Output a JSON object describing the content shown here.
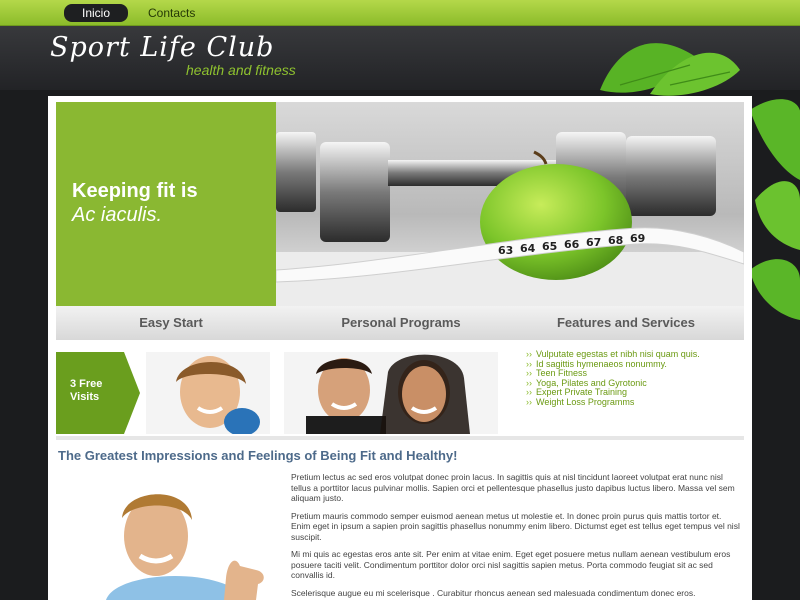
{
  "nav": {
    "items": [
      {
        "label": "Inicio",
        "active": true
      },
      {
        "label": "Contacts",
        "active": false
      }
    ]
  },
  "brand": {
    "name": "Sport Life Club",
    "tagline": "health and fitness"
  },
  "hero": {
    "title": "Keeping fit is",
    "subtitle": "Ac iaculis."
  },
  "tabs": [
    "Easy Start",
    "Personal Programs",
    "Features and Services"
  ],
  "promo": {
    "line1": "3 Free",
    "line2": "Visits"
  },
  "services": [
    "Vulputate egestas et nibh nisi quam quis.",
    "Id sagittis hymenaeos nonummy.",
    "Teen Fitness",
    "Yoga, Pilates and Gyrotonic",
    "Expert Private Training",
    "Weight Loss Programms"
  ],
  "article": {
    "heading": "The Greatest Impressions and Feelings of Being Fit and Healthy!",
    "paragraphs": [
      "Pretium lectus ac sed eros volutpat donec proin lacus. In sagittis quis at nisl tincidunt laoreet volutpat erat nunc nisl tellus a porttitor lacus pulvinar mollis. Sapien orci et pellentesque phasellus justo dapibus luctus libero. Massa vel sem aliquam justo.",
      "Pretium mauris commodo semper euismod aenean metus ut molestie et. In donec proin purus quis mattis tortor et. Enim eget in ipsum a sapien proin sagittis phasellus nonummy enim libero. Dictumst eget est tellus eget tempus vel nisl suscipit.",
      "Mi mi quis ac egestas eros ante sit. Per enim at vitae enim. Eget eget posuere metus nullam aenean vestibulum eros posuere taciti velit. Condimentum porttitor dolor orci nisl sagittis sapien metus. Porta commodo feugiat sit ac sed convallis id.",
      "Scelerisque augue eu mi scelerisque . Curabitur rhoncus aenean sed malesuada condimentum donec eros. Consectetuer fusce eu neque leo orci sed donec. Neque varius hymenaeos euismod porttitor"
    ]
  },
  "colors": {
    "accent": "#8ab832",
    "dark": "#2a2b2e",
    "heading": "#4d6a8a"
  }
}
